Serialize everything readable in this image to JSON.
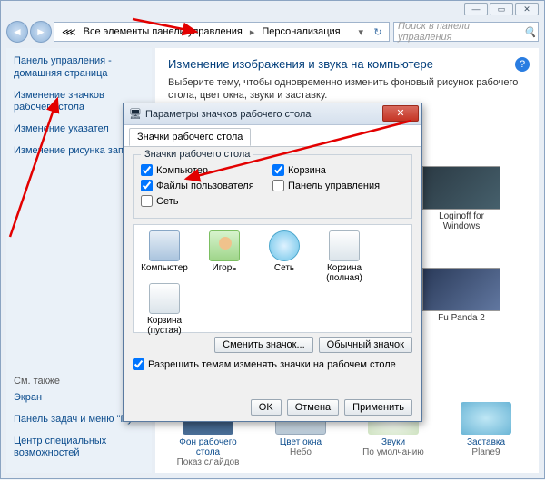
{
  "breadcrumb": {
    "all_items": "Все элементы панели управления",
    "here": "Персонализация"
  },
  "search": {
    "placeholder": "Поиск в панели управления"
  },
  "sidebar": {
    "home": "Панель управления - домашняя страница",
    "link_icons": "Изменение значков рабочего стола",
    "link_pointers": "Изменение указател",
    "link_picture": "Изменение рисунка записи",
    "see_also": "См. также",
    "screen": "Экран",
    "taskbar": "Панель задач и меню \"Пуск\"",
    "ease": "Центр специальных возможностей"
  },
  "main": {
    "title": "Изменение изображения и звука на компьютере",
    "subtitle": "Выберите тему, чтобы одновременно изменить фоновый рисунок рабочего стола, цвет окна, звуки и заставку."
  },
  "themes": {
    "t1": "Loginoff for Windows",
    "t2": "Fu Panda 2",
    "t3": "Plane9"
  },
  "bottom": {
    "bg": "Фон рабочего стола",
    "bg_sub": "Показ слайдов",
    "wc": "Цвет окна",
    "wc_sub": "Небо",
    "snd": "Звуки",
    "snd_sub": "По умолчанию",
    "scr": "Заставка",
    "scr_sub": "Plane9"
  },
  "dialog": {
    "title": "Параметры значков рабочего стола",
    "tab": "Значки рабочего стола",
    "group": "Значки рабочего стола",
    "chk_computer": "Компьютер",
    "chk_recycle": "Корзина",
    "chk_userfiles": "Файлы пользователя",
    "chk_cpl": "Панель управления",
    "chk_network": "Сеть",
    "preview": {
      "computer": "Компьютер",
      "user": "Игорь",
      "network": "Сеть",
      "bin_full": "Корзина (полная)",
      "bin_empty": "Корзина (пустая)"
    },
    "btn_change": "Сменить значок...",
    "btn_default": "Обычный значок",
    "allow": "Разрешить темам изменять значки на рабочем столе",
    "ok": "OK",
    "cancel": "Отмена",
    "apply": "Применить"
  }
}
